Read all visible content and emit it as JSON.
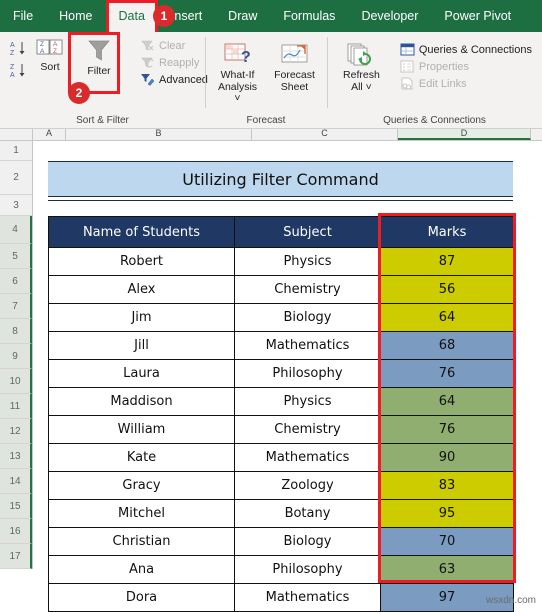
{
  "ribbon": {
    "tabs": [
      {
        "label": "File",
        "active": false
      },
      {
        "label": "Home",
        "active": false
      },
      {
        "label": "Data",
        "active": true
      },
      {
        "label": "Insert",
        "active": false
      },
      {
        "label": "Draw",
        "active": false
      },
      {
        "label": "Formulas",
        "active": false
      },
      {
        "label": "Developer",
        "active": false
      },
      {
        "label": "Power Pivot",
        "active": false
      }
    ],
    "groups": [
      {
        "title": "Sort & Filter",
        "sort_label": "Sort",
        "filter_label": "Filter",
        "items": [
          {
            "label": "Clear",
            "icon": "clear-filter-icon",
            "disabled": true
          },
          {
            "label": "Reapply",
            "icon": "reapply-icon",
            "disabled": true
          },
          {
            "label": "Advanced",
            "icon": "advanced-filter-icon",
            "disabled": false
          }
        ]
      },
      {
        "title": "Forecast",
        "what_if_label_1": "What-If",
        "what_if_label_2": "Analysis",
        "forecast_label_1": "Forecast",
        "forecast_label_2": "Sheet"
      },
      {
        "title": "Queries & Connections",
        "refresh_label_1": "Refresh",
        "refresh_label_2": "All",
        "items": [
          {
            "label": "Queries & Connections",
            "icon": "queries-icon",
            "disabled": false
          },
          {
            "label": "Properties",
            "icon": "properties-icon",
            "disabled": true
          },
          {
            "label": "Edit Links",
            "icon": "edit-links-icon",
            "disabled": true
          }
        ]
      }
    ],
    "badges": [
      {
        "id": "1",
        "target": "data-tab"
      },
      {
        "id": "2",
        "target": "filter-button"
      }
    ]
  },
  "sheet": {
    "column_headers": [
      "A",
      "B",
      "C",
      "D"
    ],
    "selected_column": "D",
    "row_numbers": [
      "1",
      "2",
      "3",
      "4",
      "5",
      "6",
      "7",
      "8",
      "9",
      "10",
      "11",
      "12",
      "13",
      "14",
      "15",
      "16",
      "17"
    ],
    "selected_rows": [
      "4",
      "5",
      "6",
      "7",
      "8",
      "9",
      "10",
      "11",
      "12",
      "13",
      "14",
      "15",
      "16",
      "17"
    ],
    "title": "Utilizing Filter Command",
    "watermark": "wsxdn.com"
  },
  "table": {
    "headers": [
      "Name of Students",
      "Subject",
      "Marks"
    ],
    "rows": [
      {
        "name": "Robert",
        "subject": "Physics",
        "marks": "87",
        "color": "#cccc00"
      },
      {
        "name": "Alex",
        "subject": "Chemistry",
        "marks": "56",
        "color": "#cccc00"
      },
      {
        "name": "Jim",
        "subject": "Biology",
        "marks": "64",
        "color": "#cccc00"
      },
      {
        "name": "Jill",
        "subject": "Mathematics",
        "marks": "68",
        "color": "#7b9cc0"
      },
      {
        "name": "Laura",
        "subject": "Philosophy",
        "marks": "76",
        "color": "#7b9cc0"
      },
      {
        "name": "Maddison",
        "subject": "Physics",
        "marks": "64",
        "color": "#8fae70"
      },
      {
        "name": "William",
        "subject": "Chemistry",
        "marks": "76",
        "color": "#8fae70"
      },
      {
        "name": "Kate",
        "subject": "Mathematics",
        "marks": "90",
        "color": "#8fae70"
      },
      {
        "name": "Gracy",
        "subject": "Zoology",
        "marks": "83",
        "color": "#cccc00"
      },
      {
        "name": "Mitchel",
        "subject": "Botany",
        "marks": "95",
        "color": "#cccc00"
      },
      {
        "name": "Christian",
        "subject": "Biology",
        "marks": "70",
        "color": "#7b9cc0"
      },
      {
        "name": "Ana",
        "subject": "Philosophy",
        "marks": "63",
        "color": "#8fae70"
      },
      {
        "name": "Dora",
        "subject": "Mathematics",
        "marks": "97",
        "color": "#7b9cc0"
      }
    ]
  },
  "colors": {
    "ribbon_green": "#1d6f42",
    "header_navy": "#1f3864",
    "title_blue": "#bdd7ee",
    "highlight_red": "#ee1c25",
    "badge_red": "#d92b2b"
  }
}
